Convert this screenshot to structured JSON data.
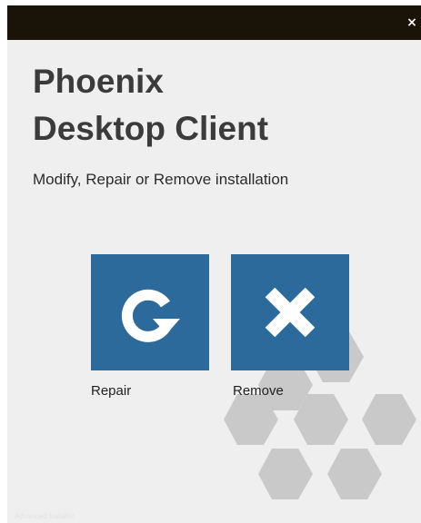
{
  "window": {
    "close_symbol": "×"
  },
  "header": {
    "title_line1": "Phoenix",
    "title_line2": "Desktop Client",
    "subtitle": "Modify, Repair or Remove installation"
  },
  "actions": [
    {
      "label": "Repair",
      "icon": "refresh-icon"
    },
    {
      "label": "Remove",
      "icon": "x-icon"
    }
  ],
  "footer": {
    "note": "Advanced Installer"
  },
  "colors": {
    "titlebar": "#1a1408",
    "background": "#efefef",
    "tile": "#2d6a9c",
    "hexagon": "#c9c9c9",
    "title_text": "#3b3b3b"
  }
}
